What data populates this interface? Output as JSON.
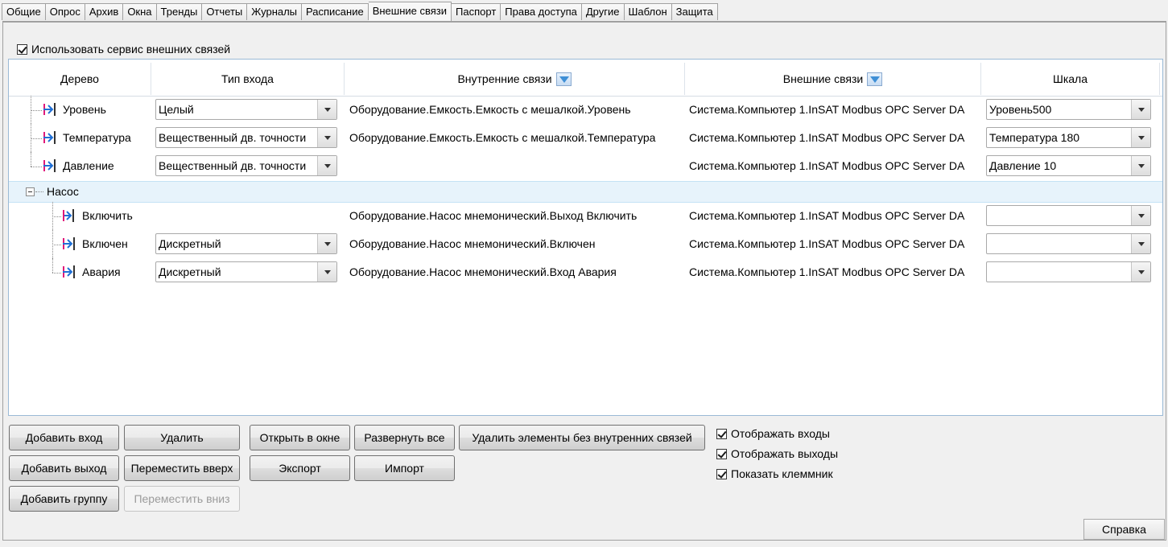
{
  "tabs": [
    {
      "label": "Общие",
      "active": false
    },
    {
      "label": "Опрос",
      "active": false
    },
    {
      "label": "Архив",
      "active": false
    },
    {
      "label": "Окна",
      "active": false
    },
    {
      "label": "Тренды",
      "active": false
    },
    {
      "label": "Отчеты",
      "active": false
    },
    {
      "label": "Журналы",
      "active": false
    },
    {
      "label": "Расписание",
      "active": false
    },
    {
      "label": "Внешние связи",
      "active": true
    },
    {
      "label": "Паспорт",
      "active": false
    },
    {
      "label": "Права доступа",
      "active": false
    },
    {
      "label": "Другие",
      "active": false
    },
    {
      "label": "Шаблон",
      "active": false
    },
    {
      "label": "Защита",
      "active": false
    }
  ],
  "use_service": {
    "label": "Использовать сервис внешних связей",
    "checked": true
  },
  "grid": {
    "headers": {
      "tree": "Дерево",
      "input_type": "Тип входа",
      "internal": "Внутренние связи",
      "external": "Внешние связи",
      "scale": "Шкала"
    },
    "rows": [
      {
        "name": "Уровень",
        "kind": "input",
        "input_type": "Целый",
        "internal": "Оборудование.Емкость.Емкость с мешалкой.Уровень",
        "external": "Система.Компьютер 1.InSAT Modbus OPC Server DA",
        "scale": "Уровень500"
      },
      {
        "name": "Температура",
        "kind": "input",
        "input_type": "Вещественный дв. точности",
        "internal": "Оборудование.Емкость.Емкость с мешалкой.Температура",
        "external": "Система.Компьютер 1.InSAT Modbus OPC Server DA",
        "scale": "Температура 180"
      },
      {
        "name": "Давление",
        "kind": "input",
        "input_type": "Вещественный дв. точности",
        "internal": "",
        "external": "Система.Компьютер 1.InSAT Modbus OPC Server DA",
        "scale": "Давление 10"
      },
      {
        "name": "Насос",
        "kind": "group"
      },
      {
        "name": "Включить",
        "kind": "output",
        "input_type": "",
        "internal": "Оборудование.Насос мнемонический.Выход Включить",
        "external": "Система.Компьютер 1.InSAT Modbus OPC Server DA",
        "scale": ""
      },
      {
        "name": "Включен",
        "kind": "input",
        "input_type": "Дискретный",
        "internal": "Оборудование.Насос мнемонический.Включен",
        "external": "Система.Компьютер 1.InSAT Modbus OPC Server DA",
        "scale": ""
      },
      {
        "name": "Авария",
        "kind": "input",
        "input_type": "Дискретный",
        "internal": "Оборудование.Насос мнемонический.Вход Авария",
        "external": "Система.Компьютер 1.InSAT Modbus OPC Server DA",
        "scale": ""
      }
    ]
  },
  "buttons": {
    "add_input": "Добавить вход",
    "delete": "Удалить",
    "open_window": "Открыть в окне",
    "expand_all": "Развернуть все",
    "delete_unlinked": "Удалить элементы без внутренних связей",
    "add_output": "Добавить выход",
    "move_up": "Переместить вверх",
    "export": "Экспорт",
    "import": "Импорт",
    "add_group": "Добавить группу",
    "move_down": "Переместить вниз"
  },
  "options": {
    "show_inputs": {
      "label": "Отображать входы",
      "checked": true
    },
    "show_outputs": {
      "label": "Отображать выходы",
      "checked": true
    },
    "show_terminal": {
      "label": "Показать клеммник",
      "checked": true
    }
  },
  "help": "Справка",
  "colors": {
    "group_row": "#e7f3fb",
    "filter_icon": "#3e8fd6",
    "io_arrow": "#1f6fd6",
    "io_bar": "#e0197a"
  }
}
